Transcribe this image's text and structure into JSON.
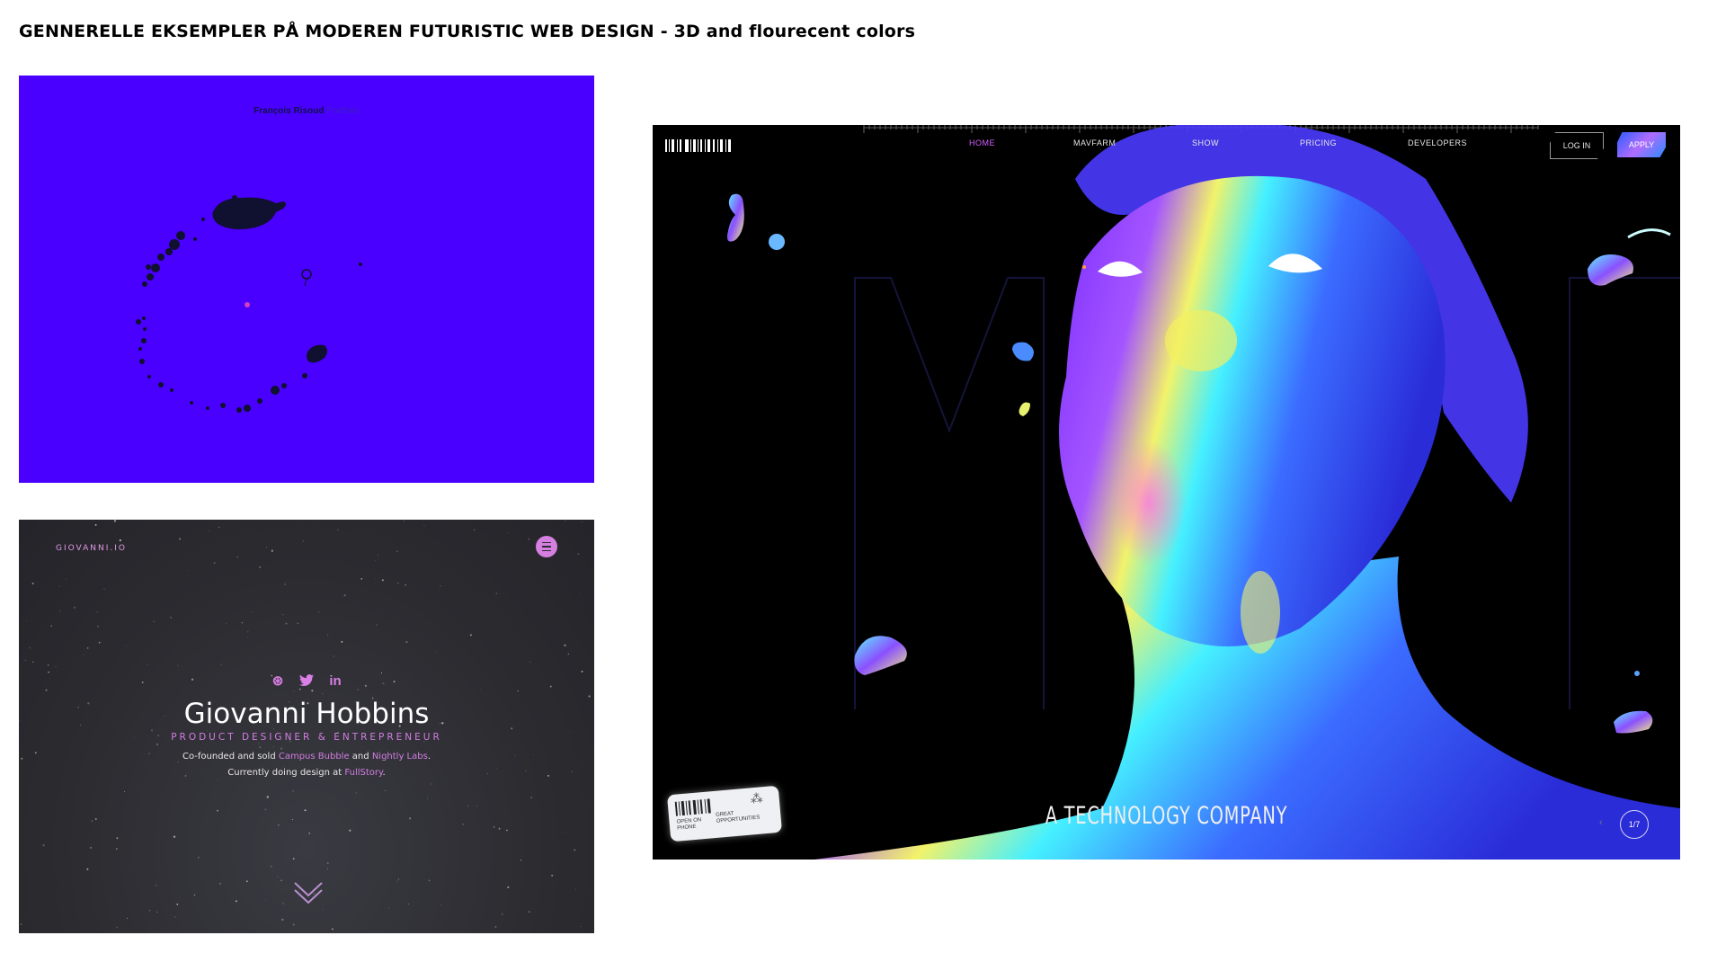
{
  "page": {
    "title": "GENNERELLE EKSEMPLER PÅ MODEREN FUTURISTIC WEB DESIGN - 3D and flourecent colors"
  },
  "blue_site": {
    "author": "François Risoud",
    "subtitle": "Portfolio",
    "background": "#4a00ff"
  },
  "dark_site": {
    "logo": "GIOVANNI.IO",
    "menu_icon": "menu-icon",
    "social_icons": [
      "dribbble-icon",
      "twitter-icon",
      "linkedin-icon"
    ],
    "social_glyphs": {
      "dribbble": "⊛",
      "twitter": "🐦",
      "linkedin": "in"
    },
    "name": "Giovanni Hobbins",
    "role": "PRODUCT DESIGNER & ENTREPRENEUR",
    "line1": {
      "prefix": "Co-founded and sold",
      "link1": "Campus Bubble",
      "mid": "and",
      "link2": "Nightly Labs",
      "suffix": "."
    },
    "line2": {
      "prefix": "Currently doing design at",
      "link": "FullStory",
      "suffix": "."
    },
    "accent": "#d37ee3"
  },
  "tech_site": {
    "nav": [
      "HOME",
      "MAVFARM",
      "SHOW",
      "PRICING",
      "DEVELOPERS"
    ],
    "active_nav": "HOME",
    "login": "LOG IN",
    "apply": "APPLY",
    "tagline": "A TECHNOLOGY COMPANY",
    "ticket": {
      "text1": "OPEN ON PHONE",
      "text2": "GREAT OPPORTUNITIES"
    },
    "pager": "1/7",
    "prev_arrow": "‹"
  }
}
